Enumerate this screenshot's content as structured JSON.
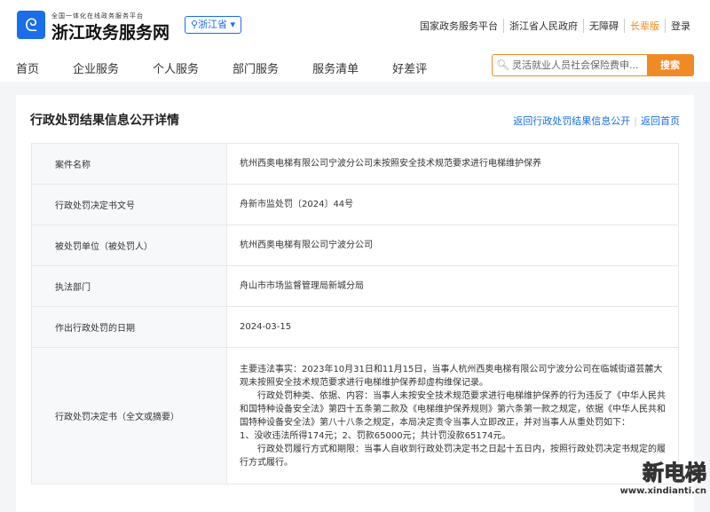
{
  "header": {
    "logo_icon": "zhejiang-logo",
    "slogan": "全国一体化在线政务服务平台",
    "site_name": "浙江政务服务网",
    "region": "浙江省",
    "top_links": [
      "国家政务服务平台",
      "浙江省人民政府",
      "无障碍",
      "长辈版",
      "登录"
    ],
    "nav": [
      "首页",
      "企业服务",
      "个人服务",
      "部门服务",
      "服务清单",
      "好差评"
    ],
    "search_placeholder": "灵活就业人员社会保险费申...",
    "search_button": "搜索"
  },
  "page": {
    "title": "行政处罚结果信息公开详情",
    "back_list": "返回行政处罚结果信息公开",
    "back_home": "返回首页"
  },
  "rows": [
    {
      "label": "案件名称",
      "value": "杭州西奥电梯有限公司宁波分公司未按照安全技术规范要求进行电梯维护保养"
    },
    {
      "label": "行政处罚决定书文号",
      "value": "舟新市监处罚〔2024〕44号"
    },
    {
      "label": "被处罚单位（被处罚人）",
      "value": "杭州西奥电梯有限公司宁波分公司"
    },
    {
      "label": "执法部门",
      "value": "舟山市市场监督管理局新城分局"
    },
    {
      "label": "作出行政处罚的日期",
      "value": "2024-03-15"
    },
    {
      "label": "行政处罚决定书（全文或摘要）",
      "paragraphs": [
        "主要违法事实：2023年10月31日和11月15日，当事人杭州西奥电梯有限公司宁波分公司在临城街道芸麓大观未按照安全技术规范要求进行电梯维护保养却虚构维保记录。",
        "行政处罚种类、依据、内容：当事人未按安全技术规范要求进行电梯维护保养的行为违反了《中华人民共和国特种设备安全法》第四十五条第二款及《电梯维护保养规则》第六条第一款之规定，依据《中华人民共和国特种设备安全法》第八十八条之规定，本局决定责令当事人立即改正，并对当事人从重处罚如下：",
        "1、没收违法所得174元；2、罚款65000元；共计罚没款65174元。",
        "行政处罚履行方式和期限：当事人自收到行政处罚决定书之日起十五日内，按照行政处罚决定书规定的履行方式履行。"
      ]
    }
  ],
  "watermark": {
    "name": "新电梯",
    "url": "www.xindianti.cn"
  }
}
